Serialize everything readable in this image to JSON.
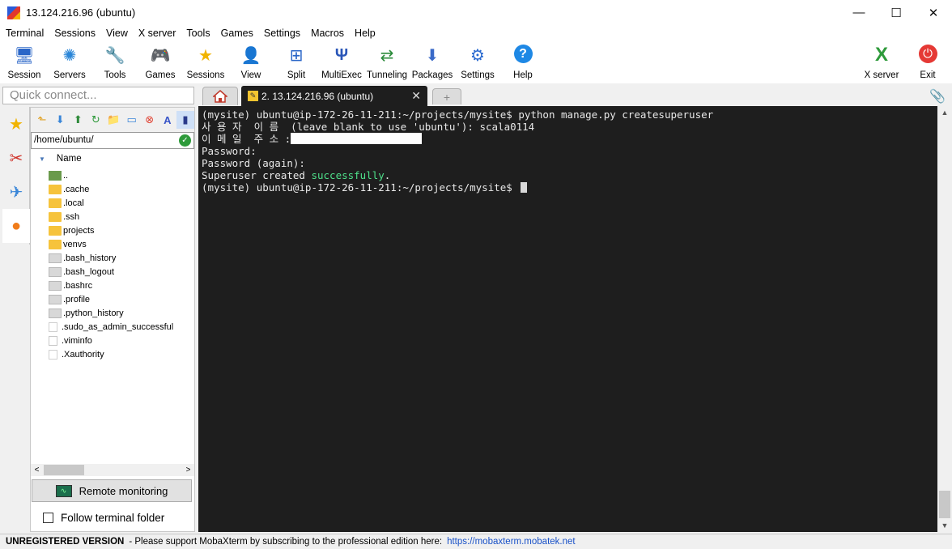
{
  "window": {
    "title": "13.124.216.96 (ubuntu)",
    "minimize": "—",
    "maximize": "☐",
    "close": "✕"
  },
  "menu": [
    "Terminal",
    "Sessions",
    "View",
    "X server",
    "Tools",
    "Games",
    "Settings",
    "Macros",
    "Help"
  ],
  "toolbar": [
    {
      "label": "Session",
      "icon": "session-icon",
      "glyph": "🖥"
    },
    {
      "label": "Servers",
      "icon": "servers-icon",
      "glyph": "✺"
    },
    {
      "label": "Tools",
      "icon": "tools-icon",
      "glyph": "🔧"
    },
    {
      "label": "Games",
      "icon": "games-icon",
      "glyph": "🎮"
    },
    {
      "label": "Sessions",
      "icon": "star-icon",
      "glyph": "★"
    },
    {
      "label": "View",
      "icon": "view-icon",
      "glyph": "👤"
    },
    {
      "label": "Split",
      "icon": "split-icon",
      "glyph": "⊞"
    },
    {
      "label": "MultiExec",
      "icon": "multiexec-icon",
      "glyph": "Ψ"
    },
    {
      "label": "Tunneling",
      "icon": "tunneling-icon",
      "glyph": "⇄"
    },
    {
      "label": "Packages",
      "icon": "packages-icon",
      "glyph": "⬇"
    },
    {
      "label": "Settings",
      "icon": "settings-icon",
      "glyph": "⚙"
    },
    {
      "label": "Help",
      "icon": "help-icon",
      "glyph": "?"
    }
  ],
  "toolbar_right": [
    {
      "label": "X server",
      "icon": "x-server-icon",
      "glyph": "X"
    },
    {
      "label": "Exit",
      "icon": "power-icon",
      "glyph": "⏻"
    }
  ],
  "quick_connect": {
    "placeholder": "Quick connect..."
  },
  "tabs": {
    "active_label": "2. 13.124.216.96 (ubuntu)",
    "close": "✕",
    "add": "+"
  },
  "sftp": {
    "path": "/home/ubuntu/",
    "column": "Name",
    "files": [
      {
        "name": "..",
        "type": "up"
      },
      {
        "name": ".cache",
        "type": "folder"
      },
      {
        "name": ".local",
        "type": "folder"
      },
      {
        "name": ".ssh",
        "type": "folder"
      },
      {
        "name": "projects",
        "type": "folder"
      },
      {
        "name": "venvs",
        "type": "folder"
      },
      {
        "name": ".bash_history",
        "type": "txt"
      },
      {
        "name": ".bash_logout",
        "type": "txt"
      },
      {
        "name": ".bashrc",
        "type": "txt"
      },
      {
        "name": ".profile",
        "type": "txt"
      },
      {
        "name": ".python_history",
        "type": "txt"
      },
      {
        "name": ".sudo_as_admin_successful",
        "type": "blank"
      },
      {
        "name": ".viminfo",
        "type": "pen"
      },
      {
        "name": ".Xauthority",
        "type": "blank"
      }
    ],
    "remote_monitoring": "Remote monitoring",
    "follow_terminal": "Follow terminal folder"
  },
  "terminal": {
    "line1": "(mysite) ubuntu@ip-172-26-11-211:~/projects/mysite$ python manage.py createsuperuser",
    "line2": "사 용 자  이 름  (leave blank to use 'ubuntu'): scala0114",
    "line3": "이 메 일  주 소 :",
    "line4": "Password:",
    "line5": "Password (again):",
    "line6_prefix": "Superuser created ",
    "line6_green": "successfully",
    "line6_suffix": ".",
    "line7": "(mysite) ubuntu@ip-172-26-11-211:~/projects/mysite$ "
  },
  "status": {
    "unregistered": "UNREGISTERED VERSION",
    "message": "-  Please support MobaXterm by subscribing to the professional edition here:",
    "link": "https://mobaxterm.mobatek.net"
  },
  "colors": {
    "terminal_bg": "#1e1e1e",
    "success_green": "#4ee08a",
    "link_blue": "#1a52c8"
  }
}
